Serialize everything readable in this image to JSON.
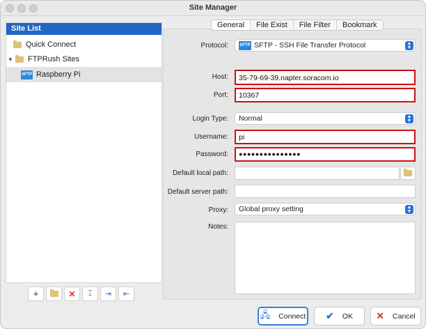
{
  "window": {
    "title": "Site Manager"
  },
  "site_list": {
    "header": "Site List",
    "items": [
      {
        "label": "Quick Connect",
        "icon": "folder-icon"
      },
      {
        "label": "FTPRush Sites",
        "icon": "folder-icon"
      },
      {
        "label": "Raspberry Pi",
        "icon": "sftp-icon",
        "icon_text": "SFTP"
      }
    ]
  },
  "tabs": [
    "General",
    "File Exist",
    "File Filter",
    "Bookmark"
  ],
  "form": {
    "protocol": {
      "label": "Protocol:",
      "value": "SFTP - SSH File Transfer Protocol",
      "icon_text": "SFTP"
    },
    "host": {
      "label": "Host:",
      "value": "35-79-69-39.napter.soracom.io"
    },
    "port": {
      "label": "Port:",
      "value": "10367"
    },
    "login_type": {
      "label": "Login Type:",
      "value": "Normal"
    },
    "username": {
      "label": "Username:",
      "value": "pi"
    },
    "password": {
      "label": "Password:",
      "value": "●●●●●●●●●●●●●●●"
    },
    "default_local_path": {
      "label": "Default local path:",
      "value": ""
    },
    "default_server_path": {
      "label": "Default server path:",
      "value": ""
    },
    "proxy": {
      "label": "Proxy:",
      "value": "Global proxy setting"
    },
    "notes": {
      "label": "Notes:",
      "value": ""
    }
  },
  "buttons": {
    "connect": "Connect",
    "ok": "OK",
    "cancel": "Cancel"
  },
  "colors": {
    "accent": "#1f66c6",
    "highlight_border": "#cc1111",
    "sftp_icon": "#2e86d9"
  }
}
